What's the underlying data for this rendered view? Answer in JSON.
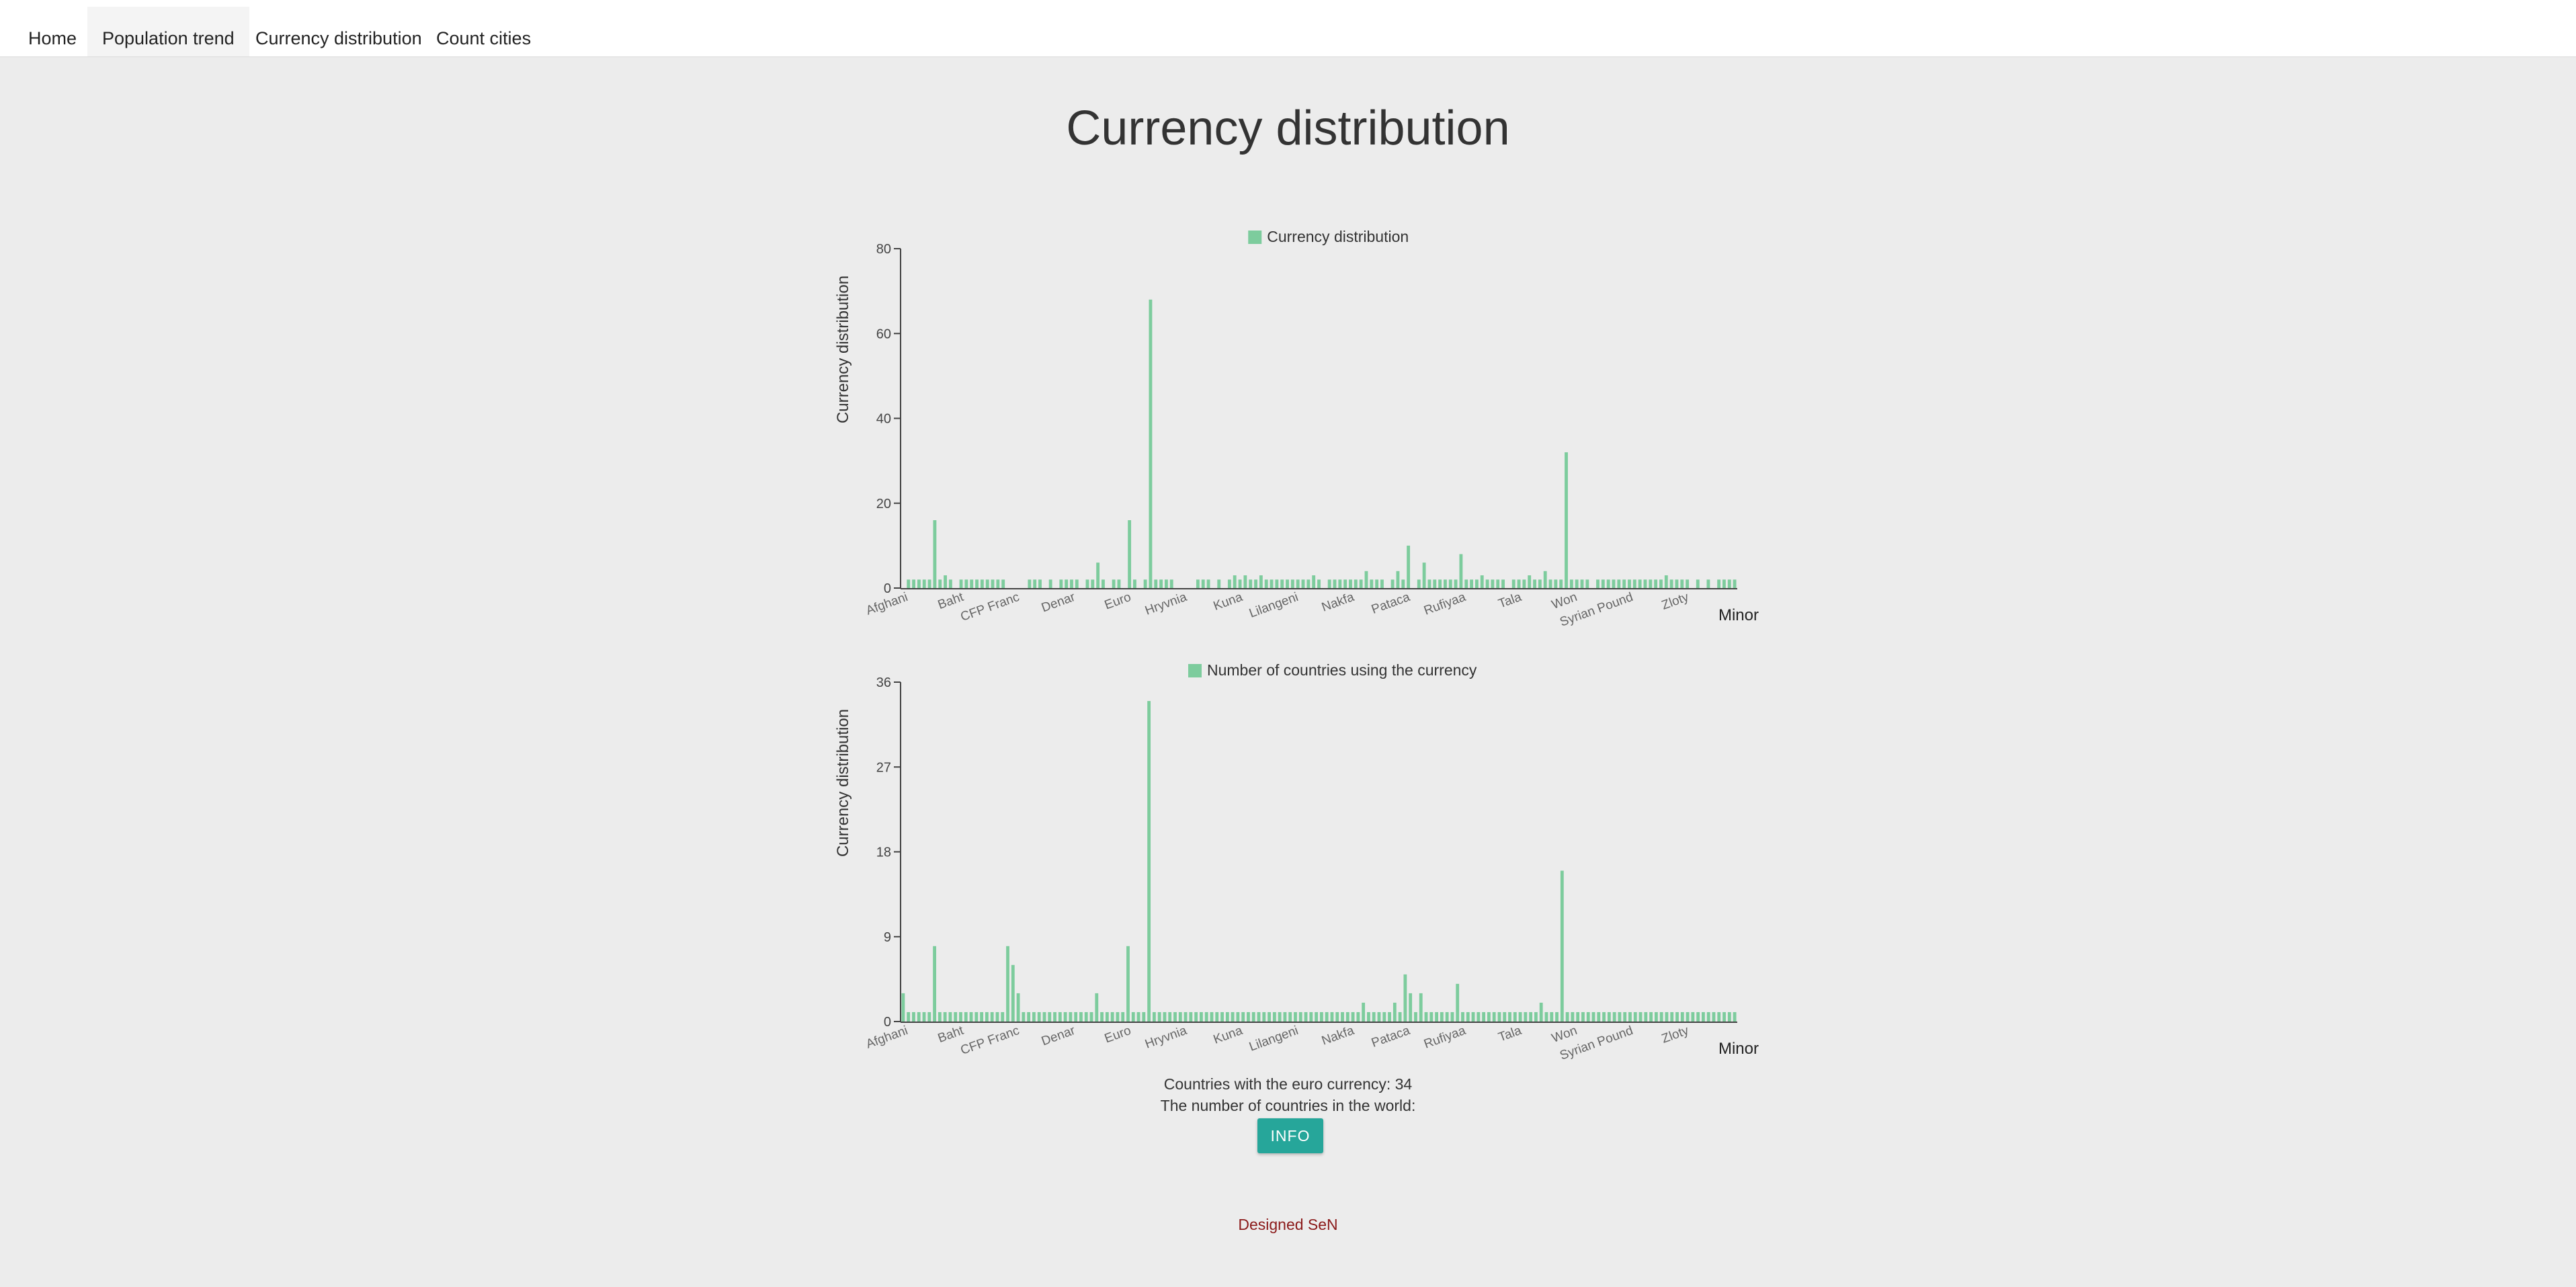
{
  "nav": {
    "items": [
      {
        "label": "Home"
      },
      {
        "label": "Population trend"
      },
      {
        "label": "Currency distribution"
      },
      {
        "label": "Count cities"
      }
    ],
    "active_index": 1
  },
  "page": {
    "title": "Currency distribution"
  },
  "colors": {
    "bar": "#7dcc9d",
    "button": "#26a69a",
    "footer": "#8b1a1a"
  },
  "chart_data": [
    {
      "type": "bar",
      "legend": "Currency distribution",
      "ylabel": "Currency distribution",
      "xlabel": "Minor",
      "ylim": [
        0,
        80
      ],
      "yticks": [
        0,
        20,
        40,
        60,
        80
      ],
      "x_tick_labels": [
        "Afghani",
        "Baht",
        "CFP Franc",
        "Denar",
        "Euro",
        "Hryvnia",
        "Kuna",
        "Lilangeni",
        "Nakfa",
        "Pataca",
        "Rufiyaa",
        "Tala",
        "Won",
        "Syrian Pound",
        "Zloty"
      ],
      "values": [
        0,
        2,
        2,
        2,
        2,
        2,
        16,
        2,
        3,
        2,
        0,
        2,
        2,
        2,
        2,
        2,
        2,
        2,
        2,
        2,
        0,
        0,
        0,
        0,
        2,
        2,
        2,
        0,
        2,
        0,
        2,
        2,
        2,
        2,
        0,
        2,
        2,
        6,
        2,
        0,
        2,
        2,
        0,
        16,
        2,
        0,
        2,
        68,
        2,
        2,
        2,
        2,
        0,
        0,
        0,
        0,
        2,
        2,
        2,
        0,
        2,
        0,
        2,
        3,
        2,
        3,
        2,
        2,
        3,
        2,
        2,
        2,
        2,
        2,
        2,
        2,
        2,
        2,
        3,
        2,
        0,
        2,
        2,
        2,
        2,
        2,
        2,
        2,
        4,
        2,
        2,
        2,
        0,
        2,
        4,
        2,
        10,
        0,
        2,
        6,
        2,
        2,
        2,
        2,
        2,
        2,
        8,
        2,
        2,
        2,
        3,
        2,
        2,
        2,
        2,
        0,
        2,
        2,
        2,
        3,
        2,
        2,
        4,
        2,
        2,
        2,
        32,
        2,
        2,
        2,
        2,
        0,
        2,
        2,
        2,
        2,
        2,
        2,
        2,
        2,
        2,
        2,
        2,
        2,
        2,
        3,
        2,
        2,
        2,
        2,
        0,
        2,
        0,
        2,
        0,
        2,
        2,
        2,
        2
      ]
    },
    {
      "type": "bar",
      "legend": "Number of countries using the currency",
      "ylabel": "Currency distribution",
      "xlabel": "Minor",
      "ylim": [
        0,
        36
      ],
      "yticks": [
        0,
        9,
        18,
        27,
        36
      ],
      "x_tick_labels": [
        "Afghani",
        "Baht",
        "CFP Franc",
        "Denar",
        "Euro",
        "Hryvnia",
        "Kuna",
        "Lilangeni",
        "Nakfa",
        "Pataca",
        "Rufiyaa",
        "Tala",
        "Won",
        "Syrian Pound",
        "Zloty"
      ],
      "values": [
        3,
        1,
        1,
        1,
        1,
        1,
        8,
        1,
        1,
        1,
        1,
        1,
        1,
        1,
        1,
        1,
        1,
        1,
        1,
        1,
        8,
        6,
        3,
        1,
        1,
        1,
        1,
        1,
        1,
        1,
        1,
        1,
        1,
        1,
        1,
        1,
        1,
        3,
        1,
        1,
        1,
        1,
        1,
        8,
        1,
        1,
        1,
        34,
        1,
        1,
        1,
        1,
        1,
        1,
        1,
        1,
        1,
        1,
        1,
        1,
        1,
        1,
        1,
        1,
        1,
        1,
        1,
        1,
        1,
        1,
        1,
        1,
        1,
        1,
        1,
        1,
        1,
        1,
        1,
        1,
        1,
        1,
        1,
        1,
        1,
        1,
        1,
        1,
        2,
        1,
        1,
        1,
        1,
        1,
        2,
        1,
        5,
        3,
        1,
        3,
        1,
        1,
        1,
        1,
        1,
        1,
        4,
        1,
        1,
        1,
        1,
        1,
        1,
        1,
        1,
        1,
        1,
        1,
        1,
        1,
        1,
        1,
        2,
        1,
        1,
        1,
        16,
        1,
        1,
        1,
        1,
        1,
        1,
        1,
        1,
        1,
        1,
        1,
        1,
        1,
        1,
        1,
        1,
        1,
        1,
        1,
        1,
        1,
        1,
        1,
        1,
        1,
        1,
        1,
        1,
        1,
        1,
        1,
        1,
        1
      ]
    }
  ],
  "info": {
    "euro_line": "Countries with the euro currency: 34",
    "world_line": "The number of countries in the world:",
    "button_label": "INFO"
  },
  "footer": {
    "text": "Designed SeN"
  }
}
